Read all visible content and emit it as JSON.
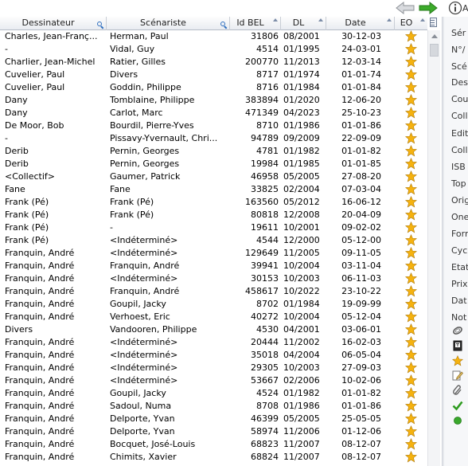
{
  "toolbar": {
    "back_icon": "back-arrow-icon",
    "forward_icon": "forward-arrow-icon",
    "info_icon": "info-icon",
    "cut_text": "A"
  },
  "columns": {
    "dessinateur": "Dessinateur",
    "scenariste": "Scénariste",
    "id_bel": "Id BEL",
    "dl": "DL",
    "date": "Date",
    "eo": "EO"
  },
  "rows": [
    {
      "dessinateur": "Charles, Jean-Franç...",
      "scenariste": "Herman, Paul",
      "id": "31806",
      "dl": "08/2001",
      "date": "30-12-03",
      "eo": "star"
    },
    {
      "dessinateur": "-",
      "scenariste": "Vidal, Guy",
      "id": "4514",
      "dl": "01/1995",
      "date": "24-03-01",
      "eo": "star"
    },
    {
      "dessinateur": "Charlier, Jean-Michel",
      "scenariste": "Ratier, Gilles",
      "id": "200770",
      "dl": "11/2013",
      "date": "12-03-14",
      "eo": "star"
    },
    {
      "dessinateur": "Cuvelier, Paul",
      "scenariste": "Divers",
      "id": "8717",
      "dl": "01/1974",
      "date": "01-01-74",
      "eo": "star"
    },
    {
      "dessinateur": "Cuvelier, Paul",
      "scenariste": "Goddin, Philippe",
      "id": "8716",
      "dl": "01/1984",
      "date": "01-01-84",
      "eo": "star"
    },
    {
      "dessinateur": "Dany",
      "scenariste": "Tomblaine, Philippe",
      "id": "383894",
      "dl": "01/2020",
      "date": "12-06-20",
      "eo": "star"
    },
    {
      "dessinateur": "Dany",
      "scenariste": "Carlot, Marc",
      "id": "471349",
      "dl": "04/2023",
      "date": "25-10-23",
      "eo": "star"
    },
    {
      "dessinateur": "De Moor, Bob",
      "scenariste": "Bourdil, Pierre-Yves",
      "id": "8710",
      "dl": "01/1986",
      "date": "01-01-86",
      "eo": "star"
    },
    {
      "dessinateur": "-",
      "scenariste": "Pissavy-Yvernault, Chri...",
      "id": "94789",
      "dl": "09/2009",
      "date": "22-09-09",
      "eo": "star"
    },
    {
      "dessinateur": "Derib",
      "scenariste": "Pernin, Georges",
      "id": "4781",
      "dl": "01/1982",
      "date": "01-01-82",
      "eo": "star"
    },
    {
      "dessinateur": "Derib",
      "scenariste": "Pernin, Georges",
      "id": "19984",
      "dl": "01/1985",
      "date": "01-01-85",
      "eo": "star"
    },
    {
      "dessinateur": "<Collectif>",
      "scenariste": "Gaumer, Patrick",
      "id": "46958",
      "dl": "05/2005",
      "date": "27-08-20",
      "eo": "star"
    },
    {
      "dessinateur": "Fane",
      "scenariste": "Fane",
      "id": "33825",
      "dl": "02/2004",
      "date": "07-03-04",
      "eo": "star"
    },
    {
      "dessinateur": "Frank (Pé)",
      "scenariste": "Frank (Pé)",
      "id": "163560",
      "dl": "05/2012",
      "date": "16-06-12",
      "eo": "star"
    },
    {
      "dessinateur": "Frank (Pé)",
      "scenariste": "Frank (Pé)",
      "id": "80818",
      "dl": "12/2008",
      "date": "20-04-09",
      "eo": "star"
    },
    {
      "dessinateur": "Frank (Pé)",
      "scenariste": "-",
      "id": "19611",
      "dl": "10/2001",
      "date": "09-02-02",
      "eo": "star"
    },
    {
      "dessinateur": "Frank (Pé)",
      "scenariste": "<Indéterminé>",
      "id": "4544",
      "dl": "12/2000",
      "date": "05-12-00",
      "eo": "star"
    },
    {
      "dessinateur": "Franquin, André",
      "scenariste": "<Indéterminé>",
      "id": "129649",
      "dl": "11/2005",
      "date": "09-11-05",
      "eo": "star"
    },
    {
      "dessinateur": "Franquin, André",
      "scenariste": "Franquin, André",
      "id": "39941",
      "dl": "10/2004",
      "date": "03-11-04",
      "eo": "star"
    },
    {
      "dessinateur": "Franquin, André",
      "scenariste": "<Indéterminé>",
      "id": "30153",
      "dl": "10/2003",
      "date": "06-11-03",
      "eo": "star"
    },
    {
      "dessinateur": "Franquin, André",
      "scenariste": "Franquin, André",
      "id": "458617",
      "dl": "10/2022",
      "date": "23-10-22",
      "eo": "star"
    },
    {
      "dessinateur": "Franquin, André",
      "scenariste": "Goupil, Jacky",
      "id": "8702",
      "dl": "01/1984",
      "date": "19-09-99",
      "eo": "star"
    },
    {
      "dessinateur": "Franquin, André",
      "scenariste": "Verhoest, Eric",
      "id": "40272",
      "dl": "10/2004",
      "date": "05-12-04",
      "eo": "star"
    },
    {
      "dessinateur": "Divers",
      "scenariste": "Vandooren, Philippe",
      "id": "4530",
      "dl": "04/2001",
      "date": "03-06-01",
      "eo": "star"
    },
    {
      "dessinateur": "Franquin, André",
      "scenariste": "<Indéterminé>",
      "id": "20444",
      "dl": "11/2002",
      "date": "16-02-03",
      "eo": "star"
    },
    {
      "dessinateur": "Franquin, André",
      "scenariste": "<Indéterminé>",
      "id": "35018",
      "dl": "04/2004",
      "date": "06-05-04",
      "eo": "star"
    },
    {
      "dessinateur": "Franquin, André",
      "scenariste": "<Indéterminé>",
      "id": "29305",
      "dl": "10/2003",
      "date": "27-09-03",
      "eo": "star"
    },
    {
      "dessinateur": "Franquin, André",
      "scenariste": "<Indéterminé>",
      "id": "53667",
      "dl": "02/2006",
      "date": "10-02-06",
      "eo": "star"
    },
    {
      "dessinateur": "Franquin, André",
      "scenariste": "Goupil, Jacky",
      "id": "4524",
      "dl": "01/1982",
      "date": "01-01-82",
      "eo": "star"
    },
    {
      "dessinateur": "Franquin, André",
      "scenariste": "Sadoul, Numa",
      "id": "8708",
      "dl": "01/1986",
      "date": "01-01-86",
      "eo": "star"
    },
    {
      "dessinateur": "Franquin, André",
      "scenariste": "Delporte, Yvan",
      "id": "46399",
      "dl": "05/2005",
      "date": "25-05-05",
      "eo": "star"
    },
    {
      "dessinateur": "Franquin, André",
      "scenariste": "Delporte, Yvan",
      "id": "58974",
      "dl": "11/2006",
      "date": "01-12-06",
      "eo": "star"
    },
    {
      "dessinateur": "Franquin, André",
      "scenariste": "Bocquet, José-Louis",
      "id": "68823",
      "dl": "11/2007",
      "date": "08-12-07",
      "eo": "star"
    },
    {
      "dessinateur": "Franquin, André",
      "scenariste": "Chimits, Xavier",
      "id": "68824",
      "dl": "11/2007",
      "date": "08-12-07",
      "eo": "star"
    }
  ],
  "side_panel": {
    "labels": [
      "Sér",
      "N°/",
      "Scé",
      "Des",
      "Cou",
      "Coll",
      "Edit",
      "Coll",
      "ISB",
      "Top",
      "Orig",
      "One",
      "Forr",
      "Cyc",
      "Etat",
      "Prix",
      "Dat",
      "Not"
    ],
    "icons": [
      "clip-icon",
      "book-icon",
      "star-icon",
      "pen-icon",
      "paperclip-icon",
      "check-icon",
      "status-dot-icon"
    ]
  },
  "colors": {
    "star": "#f5b20f",
    "check": "#2e9b1f",
    "dot": "#3aa82c",
    "nav_green": "#3cab2a"
  }
}
